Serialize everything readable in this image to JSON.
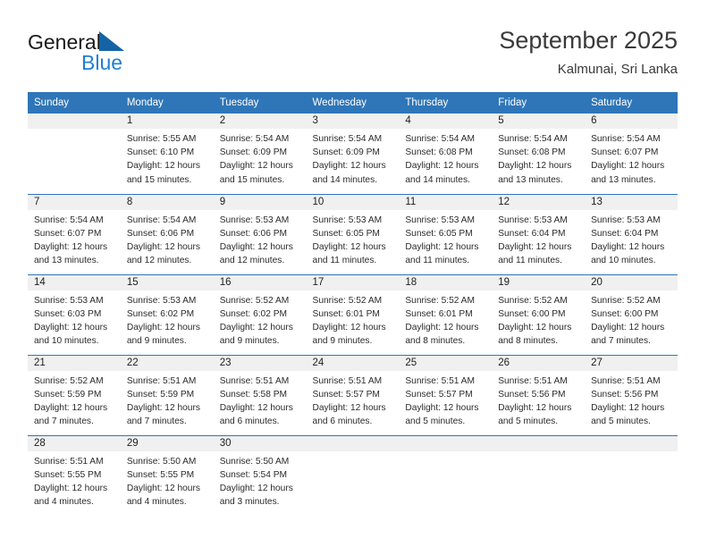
{
  "brand": {
    "name_part1": "General",
    "name_part2": "Blue",
    "triangle_icon": "triangle-logo-icon",
    "accent_color": "#1464a5",
    "blue_text_color": "#1f7fd1"
  },
  "header": {
    "title": "September 2025",
    "subtitle": "Kalmunai, Sri Lanka"
  },
  "theme": {
    "header_blue": "#2f76b8",
    "daynum_band": "#f0f0f0",
    "text": "#2b2b2b"
  },
  "weekdays": [
    "Sunday",
    "Monday",
    "Tuesday",
    "Wednesday",
    "Thursday",
    "Friday",
    "Saturday"
  ],
  "labels": {
    "sunrise_prefix": "Sunrise:",
    "sunset_prefix": "Sunset:",
    "daylight_prefix": "Daylight:"
  },
  "weeks": [
    [
      {
        "day": "",
        "line1": "",
        "line2": "",
        "line3": "",
        "line4": ""
      },
      {
        "day": "1",
        "line1": "Sunrise: 5:55 AM",
        "line2": "Sunset: 6:10 PM",
        "line3": "Daylight: 12 hours",
        "line4": "and 15 minutes."
      },
      {
        "day": "2",
        "line1": "Sunrise: 5:54 AM",
        "line2": "Sunset: 6:09 PM",
        "line3": "Daylight: 12 hours",
        "line4": "and 15 minutes."
      },
      {
        "day": "3",
        "line1": "Sunrise: 5:54 AM",
        "line2": "Sunset: 6:09 PM",
        "line3": "Daylight: 12 hours",
        "line4": "and 14 minutes."
      },
      {
        "day": "4",
        "line1": "Sunrise: 5:54 AM",
        "line2": "Sunset: 6:08 PM",
        "line3": "Daylight: 12 hours",
        "line4": "and 14 minutes."
      },
      {
        "day": "5",
        "line1": "Sunrise: 5:54 AM",
        "line2": "Sunset: 6:08 PM",
        "line3": "Daylight: 12 hours",
        "line4": "and 13 minutes."
      },
      {
        "day": "6",
        "line1": "Sunrise: 5:54 AM",
        "line2": "Sunset: 6:07 PM",
        "line3": "Daylight: 12 hours",
        "line4": "and 13 minutes."
      }
    ],
    [
      {
        "day": "7",
        "line1": "Sunrise: 5:54 AM",
        "line2": "Sunset: 6:07 PM",
        "line3": "Daylight: 12 hours",
        "line4": "and 13 minutes."
      },
      {
        "day": "8",
        "line1": "Sunrise: 5:54 AM",
        "line2": "Sunset: 6:06 PM",
        "line3": "Daylight: 12 hours",
        "line4": "and 12 minutes."
      },
      {
        "day": "9",
        "line1": "Sunrise: 5:53 AM",
        "line2": "Sunset: 6:06 PM",
        "line3": "Daylight: 12 hours",
        "line4": "and 12 minutes."
      },
      {
        "day": "10",
        "line1": "Sunrise: 5:53 AM",
        "line2": "Sunset: 6:05 PM",
        "line3": "Daylight: 12 hours",
        "line4": "and 11 minutes."
      },
      {
        "day": "11",
        "line1": "Sunrise: 5:53 AM",
        "line2": "Sunset: 6:05 PM",
        "line3": "Daylight: 12 hours",
        "line4": "and 11 minutes."
      },
      {
        "day": "12",
        "line1": "Sunrise: 5:53 AM",
        "line2": "Sunset: 6:04 PM",
        "line3": "Daylight: 12 hours",
        "line4": "and 11 minutes."
      },
      {
        "day": "13",
        "line1": "Sunrise: 5:53 AM",
        "line2": "Sunset: 6:04 PM",
        "line3": "Daylight: 12 hours",
        "line4": "and 10 minutes."
      }
    ],
    [
      {
        "day": "14",
        "line1": "Sunrise: 5:53 AM",
        "line2": "Sunset: 6:03 PM",
        "line3": "Daylight: 12 hours",
        "line4": "and 10 minutes."
      },
      {
        "day": "15",
        "line1": "Sunrise: 5:53 AM",
        "line2": "Sunset: 6:02 PM",
        "line3": "Daylight: 12 hours",
        "line4": "and 9 minutes."
      },
      {
        "day": "16",
        "line1": "Sunrise: 5:52 AM",
        "line2": "Sunset: 6:02 PM",
        "line3": "Daylight: 12 hours",
        "line4": "and 9 minutes."
      },
      {
        "day": "17",
        "line1": "Sunrise: 5:52 AM",
        "line2": "Sunset: 6:01 PM",
        "line3": "Daylight: 12 hours",
        "line4": "and 9 minutes."
      },
      {
        "day": "18",
        "line1": "Sunrise: 5:52 AM",
        "line2": "Sunset: 6:01 PM",
        "line3": "Daylight: 12 hours",
        "line4": "and 8 minutes."
      },
      {
        "day": "19",
        "line1": "Sunrise: 5:52 AM",
        "line2": "Sunset: 6:00 PM",
        "line3": "Daylight: 12 hours",
        "line4": "and 8 minutes."
      },
      {
        "day": "20",
        "line1": "Sunrise: 5:52 AM",
        "line2": "Sunset: 6:00 PM",
        "line3": "Daylight: 12 hours",
        "line4": "and 7 minutes."
      }
    ],
    [
      {
        "day": "21",
        "line1": "Sunrise: 5:52 AM",
        "line2": "Sunset: 5:59 PM",
        "line3": "Daylight: 12 hours",
        "line4": "and 7 minutes."
      },
      {
        "day": "22",
        "line1": "Sunrise: 5:51 AM",
        "line2": "Sunset: 5:59 PM",
        "line3": "Daylight: 12 hours",
        "line4": "and 7 minutes."
      },
      {
        "day": "23",
        "line1": "Sunrise: 5:51 AM",
        "line2": "Sunset: 5:58 PM",
        "line3": "Daylight: 12 hours",
        "line4": "and 6 minutes."
      },
      {
        "day": "24",
        "line1": "Sunrise: 5:51 AM",
        "line2": "Sunset: 5:57 PM",
        "line3": "Daylight: 12 hours",
        "line4": "and 6 minutes."
      },
      {
        "day": "25",
        "line1": "Sunrise: 5:51 AM",
        "line2": "Sunset: 5:57 PM",
        "line3": "Daylight: 12 hours",
        "line4": "and 5 minutes."
      },
      {
        "day": "26",
        "line1": "Sunrise: 5:51 AM",
        "line2": "Sunset: 5:56 PM",
        "line3": "Daylight: 12 hours",
        "line4": "and 5 minutes."
      },
      {
        "day": "27",
        "line1": "Sunrise: 5:51 AM",
        "line2": "Sunset: 5:56 PM",
        "line3": "Daylight: 12 hours",
        "line4": "and 5 minutes."
      }
    ],
    [
      {
        "day": "28",
        "line1": "Sunrise: 5:51 AM",
        "line2": "Sunset: 5:55 PM",
        "line3": "Daylight: 12 hours",
        "line4": "and 4 minutes."
      },
      {
        "day": "29",
        "line1": "Sunrise: 5:50 AM",
        "line2": "Sunset: 5:55 PM",
        "line3": "Daylight: 12 hours",
        "line4": "and 4 minutes."
      },
      {
        "day": "30",
        "line1": "Sunrise: 5:50 AM",
        "line2": "Sunset: 5:54 PM",
        "line3": "Daylight: 12 hours",
        "line4": "and 3 minutes."
      },
      {
        "day": "",
        "line1": "",
        "line2": "",
        "line3": "",
        "line4": ""
      },
      {
        "day": "",
        "line1": "",
        "line2": "",
        "line3": "",
        "line4": ""
      },
      {
        "day": "",
        "line1": "",
        "line2": "",
        "line3": "",
        "line4": ""
      },
      {
        "day": "",
        "line1": "",
        "line2": "",
        "line3": "",
        "line4": ""
      }
    ]
  ]
}
